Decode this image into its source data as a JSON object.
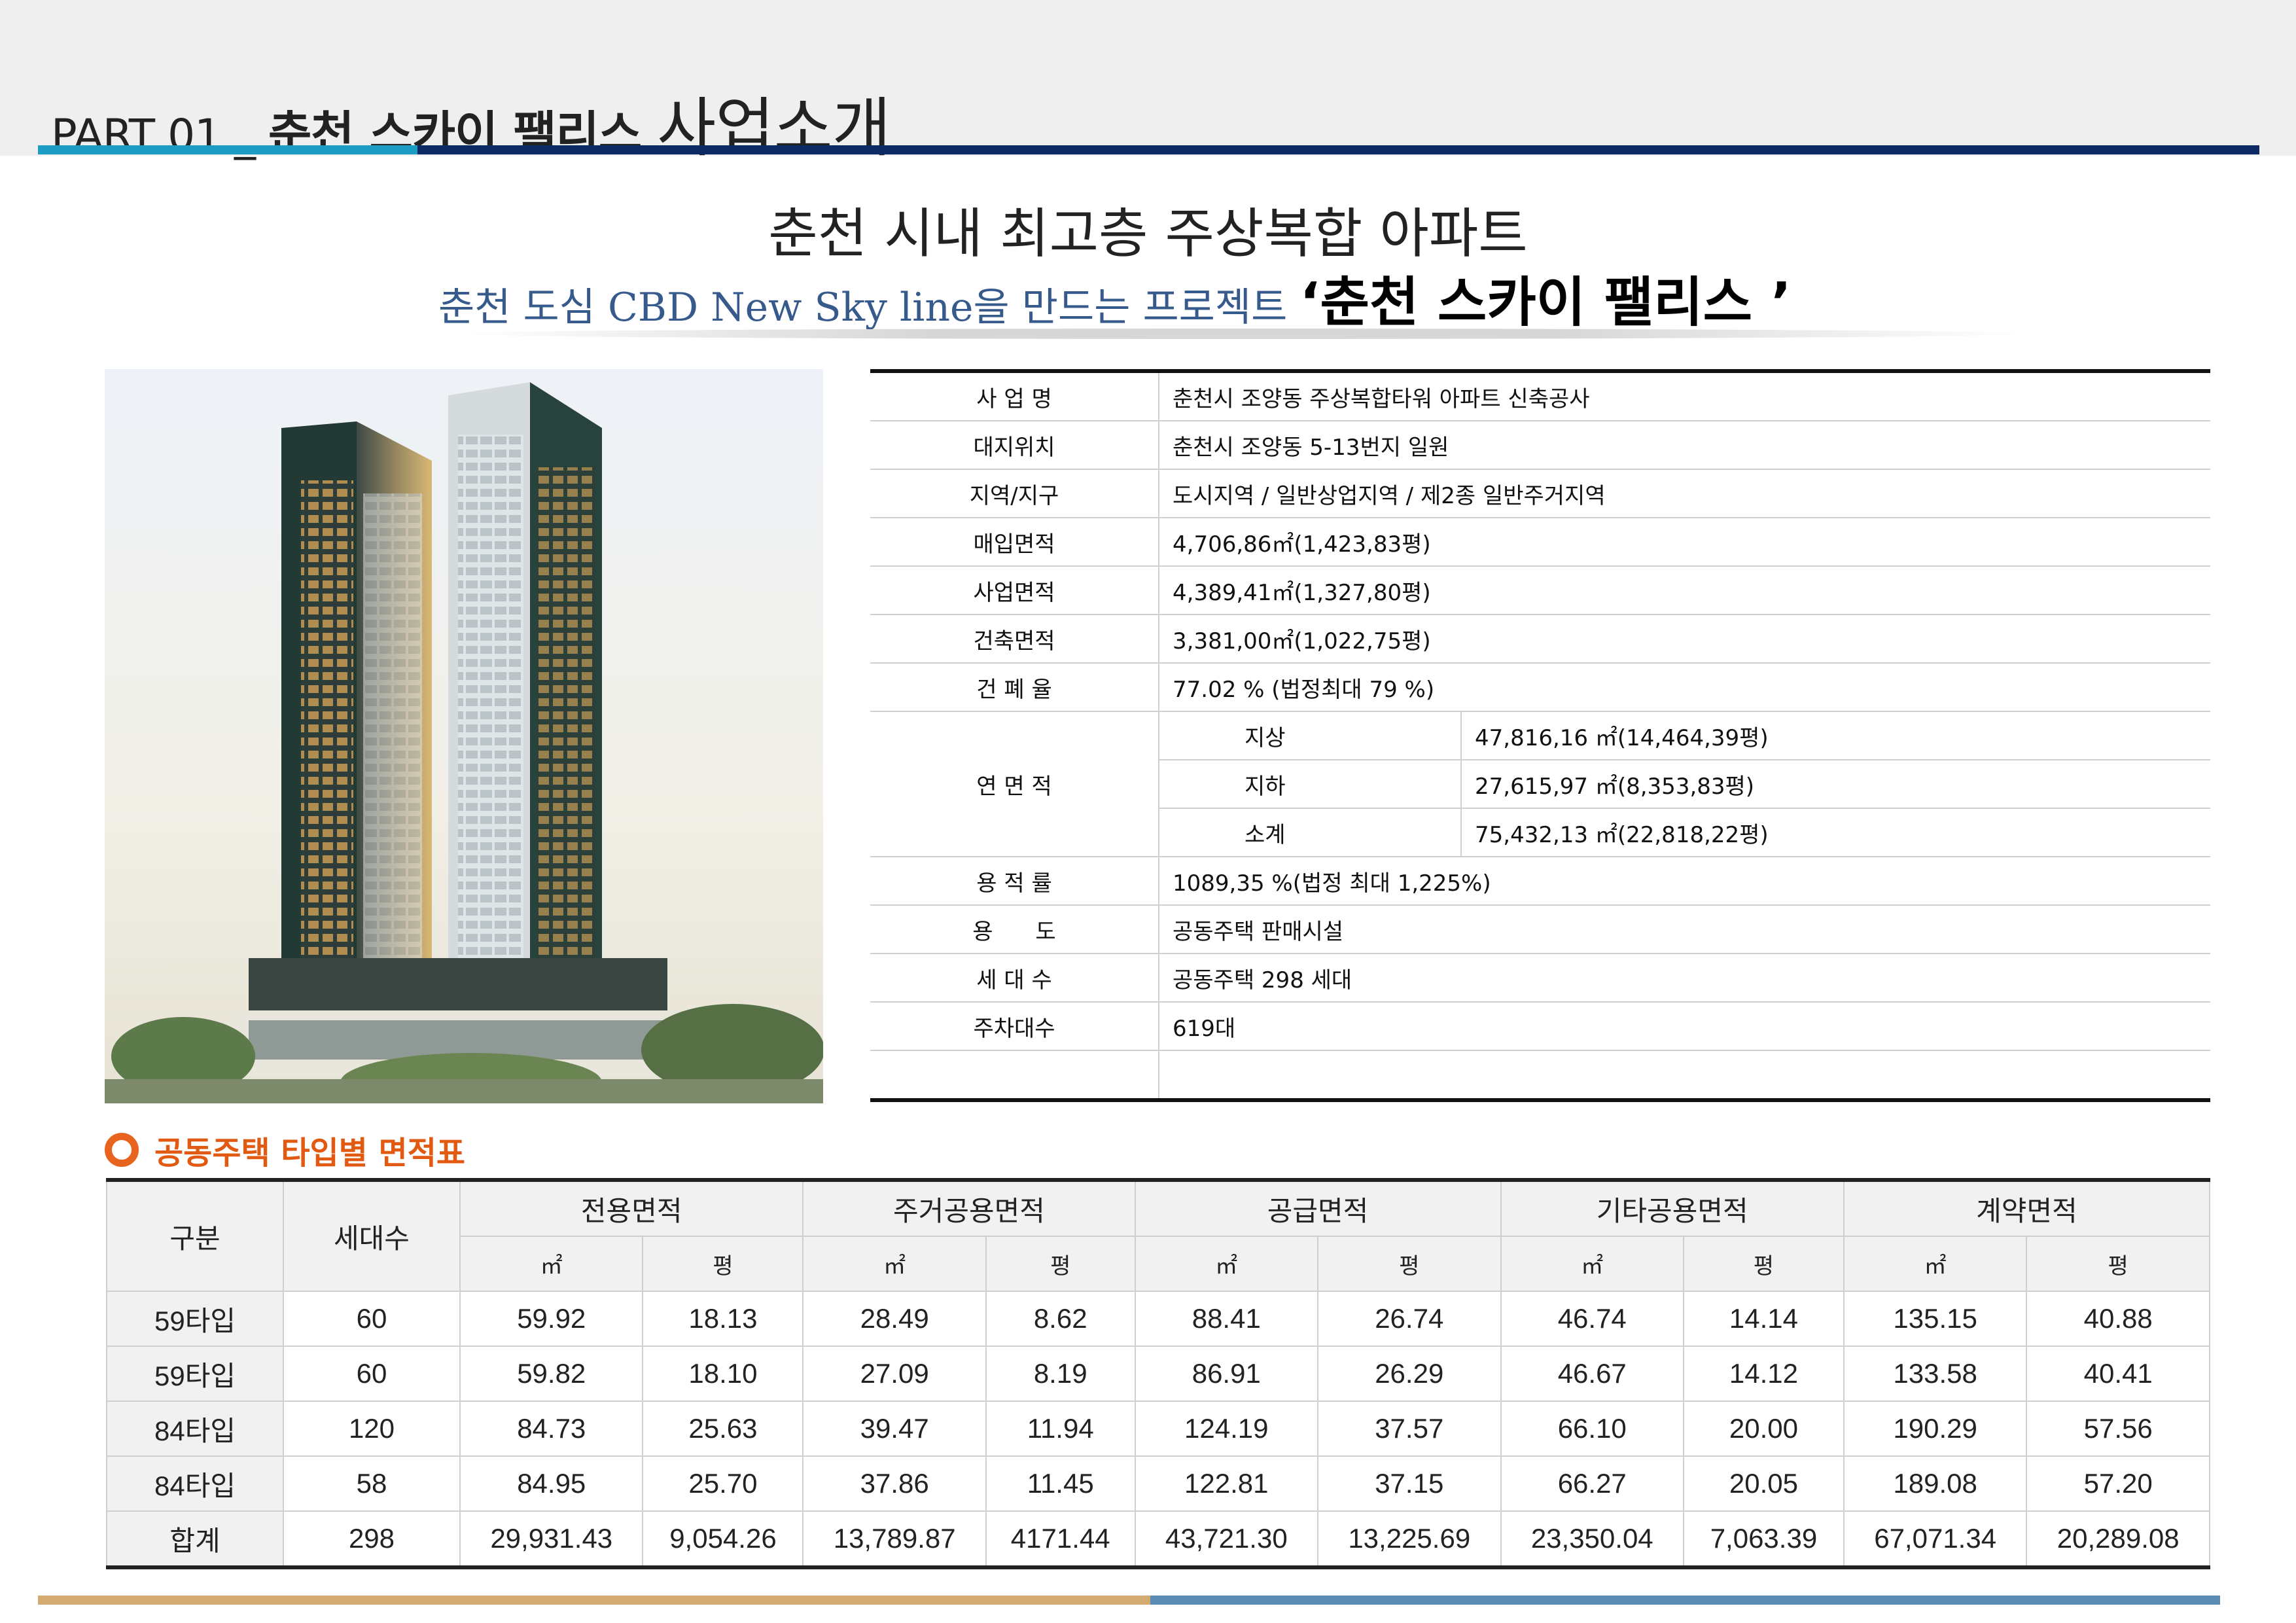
{
  "header": {
    "part_label": "PART 01 _ ",
    "title_bold": "춘천 스카이 팰리스 ",
    "title_light": "사업소개"
  },
  "headline": "춘천 시내 최고층 주상복합 아파트",
  "subline": {
    "text": "춘천 도심 CBD New Sky line을 만드는 프로젝트 ",
    "highlight": "‘춘천 스카이 팰리스 ’"
  },
  "project_info": {
    "rows": [
      {
        "label": "사 업 명",
        "value": "춘천시 조양동 주상복합타워 아파트 신축공사"
      },
      {
        "label": "대지위치",
        "value": "춘천시 조양동 5-13번지 일원"
      },
      {
        "label": "지역/지구",
        "value": "도시지역 / 일반상업지역 / 제2종 일반주거지역"
      },
      {
        "label": "매입면적",
        "value": "4,706,86㎡(1,423,83평)"
      },
      {
        "label": "사업면적",
        "value": "4,389,41㎡(1,327,80평)"
      },
      {
        "label": "건축면적",
        "value": "3,381,00㎡(1,022,75평)"
      },
      {
        "label": "건 폐 율",
        "value": "77.02 % (법정최대 79 %)"
      }
    ],
    "floor_area": {
      "label": "연 면 적",
      "rows": [
        {
          "name": "지상",
          "value": "47,816,16 ㎡(14,464,39평)"
        },
        {
          "name": "지하",
          "value": "27,615,97 ㎡(8,353,83평)"
        },
        {
          "name": "소계",
          "value": "75,432,13 ㎡(22,818,22평)"
        }
      ]
    },
    "rows_after": [
      {
        "label": "용 적 률",
        "value": "1089,35 %(법정 최대 1,225%)"
      },
      {
        "label": "용      도",
        "value": "공동주택 판매시설"
      },
      {
        "label": "세 대 수",
        "value": "공동주택 298 세대"
      },
      {
        "label": "주차대수",
        "value": "619대"
      },
      {
        "label": "",
        "value": ""
      }
    ]
  },
  "area_section": {
    "title": "공동주택 타입별 면적표",
    "headers": {
      "type": "구분",
      "units": "세대수",
      "groups": [
        "전용면적",
        "주거공용면적",
        "공급면적",
        "기타공용면적",
        "계약면적"
      ],
      "sqm": "㎡",
      "pyeong": "평"
    },
    "rows": [
      {
        "type": "59타입",
        "units": "60",
        "values": [
          "59.92",
          "18.13",
          "28.49",
          "8.62",
          "88.41",
          "26.74",
          "46.74",
          "14.14",
          "135.15",
          "40.88"
        ]
      },
      {
        "type": "59타입",
        "units": "60",
        "values": [
          "59.82",
          "18.10",
          "27.09",
          "8.19",
          "86.91",
          "26.29",
          "46.67",
          "14.12",
          "133.58",
          "40.41"
        ]
      },
      {
        "type": "84타입",
        "units": "120",
        "values": [
          "84.73",
          "25.63",
          "39.47",
          "11.94",
          "124.19",
          "37.57",
          "66.10",
          "20.00",
          "190.29",
          "57.56"
        ]
      },
      {
        "type": "84타입",
        "units": "58",
        "values": [
          "84.95",
          "25.70",
          "37.86",
          "11.45",
          "122.81",
          "37.15",
          "66.27",
          "20.05",
          "189.08",
          "57.20"
        ]
      },
      {
        "type": "합계",
        "units": "298",
        "values": [
          "29,931.43",
          "9,054.26",
          "13,789.87",
          "4171.44",
          "43,721.30",
          "13,225.69",
          "23,350.04",
          "7,063.39",
          "67,071.34",
          "20,289.08"
        ]
      }
    ]
  }
}
